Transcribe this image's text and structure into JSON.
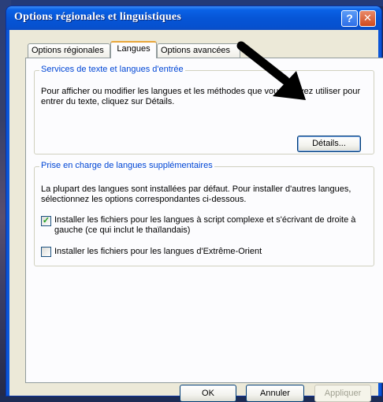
{
  "window": {
    "title": "Options régionales et linguistiques",
    "help_label": "?",
    "close_label": "X"
  },
  "tabs": [
    {
      "label": "Options régionales",
      "active": false
    },
    {
      "label": "Langues",
      "active": true
    },
    {
      "label": "Options avancées",
      "active": false
    }
  ],
  "text_services": {
    "title": "Services de texte et langues d'entrée",
    "description": "Pour afficher ou modifier les langues et les méthodes que vous pouvez utiliser pour entrer du texte, cliquez sur Détails.",
    "details_button": "Détails..."
  },
  "supplemental": {
    "title": "Prise en charge de langues supplémentaires",
    "description": "La plupart des langues sont installées par défaut. Pour installer d'autres langues, sélectionnez les options correspondantes ci-dessous.",
    "options": [
      {
        "label": "Installer les fichiers pour les langues à script complexe et s'écrivant de droite à gauche (ce qui inclut le thaïlandais)",
        "checked": true
      },
      {
        "label": "Installer les fichiers pour les langues d'Extrême-Orient",
        "checked": false
      }
    ]
  },
  "footer": {
    "ok": "OK",
    "cancel": "Annuler",
    "apply": "Appliquer",
    "apply_enabled": false
  },
  "colors": {
    "titlebar": "#0655d6",
    "group_title": "#0046d5",
    "active_tab_accent": "#e8a63a"
  }
}
